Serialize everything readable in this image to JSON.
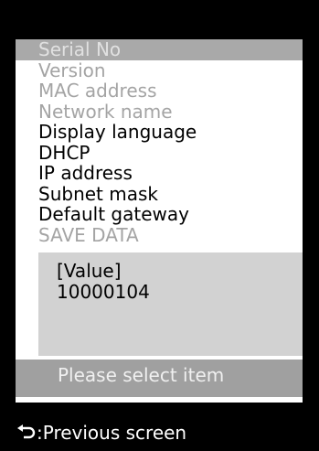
{
  "menu": {
    "items": [
      {
        "label": "Serial   No",
        "state": "selected"
      },
      {
        "label": "Version",
        "state": "disabled"
      },
      {
        "label": "MAC address",
        "state": "disabled"
      },
      {
        "label": "Network name",
        "state": "disabled"
      },
      {
        "label": "Display language",
        "state": "enabled"
      },
      {
        "label": "DHCP",
        "state": "enabled"
      },
      {
        "label": "IP address",
        "state": "enabled"
      },
      {
        "label": "Subnet mask",
        "state": "enabled"
      },
      {
        "label": "Default gateway",
        "state": "enabled"
      },
      {
        "label": "SAVE DATA",
        "state": "disabled"
      }
    ]
  },
  "value_box": {
    "label": "[Value]",
    "value": "10000104"
  },
  "status": {
    "message": "Please select item"
  },
  "footer": {
    "back_icon": "return-arrow-icon",
    "label": ":Previous screen"
  },
  "colors": {
    "background": "#000000",
    "panel": "#ffffff",
    "selected_row": "#a9a9a9",
    "disabled_text": "#a4a4a4",
    "value_box": "#d2d2d2",
    "status_bar": "#a0a0a0"
  }
}
